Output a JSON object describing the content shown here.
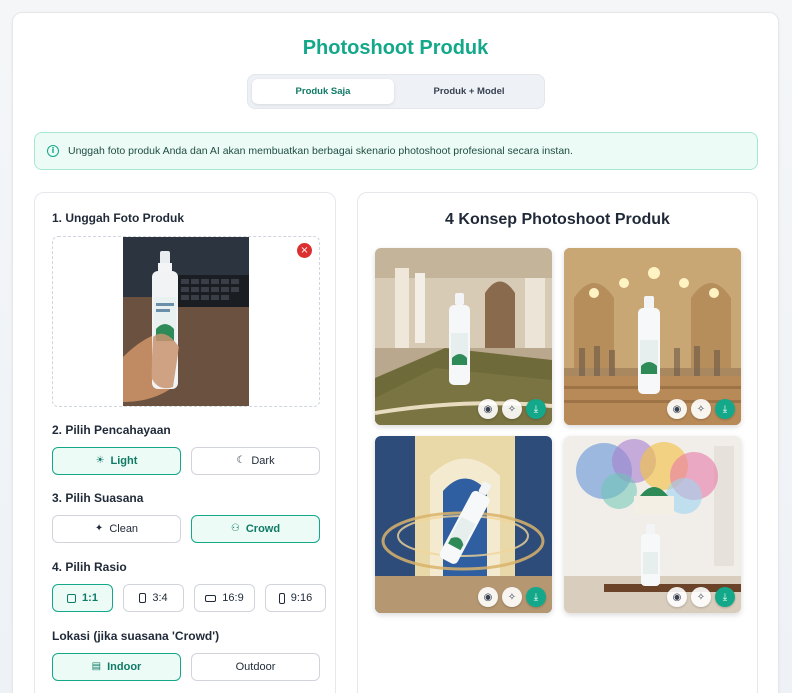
{
  "page": {
    "title": "Photoshoot Produk"
  },
  "mode_tabs": [
    {
      "label": "Produk Saja",
      "active": true
    },
    {
      "label": "Produk + Model",
      "active": false
    }
  ],
  "info": {
    "icon": "info-icon",
    "text": "Unggah foto produk Anda dan AI akan membuatkan berbagai skenario photoshoot profesional secara instan."
  },
  "upload": {
    "label": "1. Unggah Foto Produk",
    "remove_icon": "close-icon"
  },
  "lighting": {
    "label": "2. Pilih Pencahayaan",
    "options": [
      {
        "label": "Light",
        "icon": "sun-icon",
        "active": true
      },
      {
        "label": "Dark",
        "icon": "moon-icon",
        "active": false
      }
    ]
  },
  "ambience": {
    "label": "3. Pilih Suasana",
    "options": [
      {
        "label": "Clean",
        "icon": "sparkle-icon",
        "active": false
      },
      {
        "label": "Crowd",
        "icon": "users-icon",
        "active": true
      }
    ]
  },
  "ratio": {
    "label": "4. Pilih Rasio",
    "options": [
      {
        "label": "1:1",
        "active": true
      },
      {
        "label": "3:4",
        "active": false
      },
      {
        "label": "16:9",
        "active": false
      },
      {
        "label": "9:16",
        "active": false
      }
    ]
  },
  "location": {
    "label": "Lokasi (jika suasana 'Crowd')",
    "options": [
      {
        "label": "Indoor",
        "icon": "building-icon",
        "active": true
      },
      {
        "label": "Outdoor",
        "active": false
      }
    ]
  },
  "results": {
    "title": "4 Konsep Photoshoot Produk",
    "actions": [
      "eye-icon",
      "magic-wand-icon",
      "download-icon"
    ]
  },
  "colors": {
    "accent": "#14a88a",
    "danger": "#dc2f2f"
  }
}
